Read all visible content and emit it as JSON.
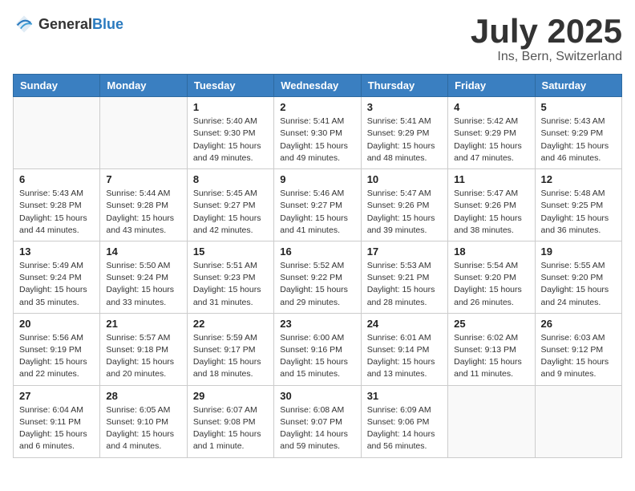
{
  "logo": {
    "general": "General",
    "blue": "Blue"
  },
  "header": {
    "month": "July 2025",
    "location": "Ins, Bern, Switzerland"
  },
  "weekdays": [
    "Sunday",
    "Monday",
    "Tuesday",
    "Wednesday",
    "Thursday",
    "Friday",
    "Saturday"
  ],
  "weeks": [
    [
      {
        "day": "",
        "info": ""
      },
      {
        "day": "",
        "info": ""
      },
      {
        "day": "1",
        "info": "Sunrise: 5:40 AM\nSunset: 9:30 PM\nDaylight: 15 hours and 49 minutes."
      },
      {
        "day": "2",
        "info": "Sunrise: 5:41 AM\nSunset: 9:30 PM\nDaylight: 15 hours and 49 minutes."
      },
      {
        "day": "3",
        "info": "Sunrise: 5:41 AM\nSunset: 9:29 PM\nDaylight: 15 hours and 48 minutes."
      },
      {
        "day": "4",
        "info": "Sunrise: 5:42 AM\nSunset: 9:29 PM\nDaylight: 15 hours and 47 minutes."
      },
      {
        "day": "5",
        "info": "Sunrise: 5:43 AM\nSunset: 9:29 PM\nDaylight: 15 hours and 46 minutes."
      }
    ],
    [
      {
        "day": "6",
        "info": "Sunrise: 5:43 AM\nSunset: 9:28 PM\nDaylight: 15 hours and 44 minutes."
      },
      {
        "day": "7",
        "info": "Sunrise: 5:44 AM\nSunset: 9:28 PM\nDaylight: 15 hours and 43 minutes."
      },
      {
        "day": "8",
        "info": "Sunrise: 5:45 AM\nSunset: 9:27 PM\nDaylight: 15 hours and 42 minutes."
      },
      {
        "day": "9",
        "info": "Sunrise: 5:46 AM\nSunset: 9:27 PM\nDaylight: 15 hours and 41 minutes."
      },
      {
        "day": "10",
        "info": "Sunrise: 5:47 AM\nSunset: 9:26 PM\nDaylight: 15 hours and 39 minutes."
      },
      {
        "day": "11",
        "info": "Sunrise: 5:47 AM\nSunset: 9:26 PM\nDaylight: 15 hours and 38 minutes."
      },
      {
        "day": "12",
        "info": "Sunrise: 5:48 AM\nSunset: 9:25 PM\nDaylight: 15 hours and 36 minutes."
      }
    ],
    [
      {
        "day": "13",
        "info": "Sunrise: 5:49 AM\nSunset: 9:24 PM\nDaylight: 15 hours and 35 minutes."
      },
      {
        "day": "14",
        "info": "Sunrise: 5:50 AM\nSunset: 9:24 PM\nDaylight: 15 hours and 33 minutes."
      },
      {
        "day": "15",
        "info": "Sunrise: 5:51 AM\nSunset: 9:23 PM\nDaylight: 15 hours and 31 minutes."
      },
      {
        "day": "16",
        "info": "Sunrise: 5:52 AM\nSunset: 9:22 PM\nDaylight: 15 hours and 29 minutes."
      },
      {
        "day": "17",
        "info": "Sunrise: 5:53 AM\nSunset: 9:21 PM\nDaylight: 15 hours and 28 minutes."
      },
      {
        "day": "18",
        "info": "Sunrise: 5:54 AM\nSunset: 9:20 PM\nDaylight: 15 hours and 26 minutes."
      },
      {
        "day": "19",
        "info": "Sunrise: 5:55 AM\nSunset: 9:20 PM\nDaylight: 15 hours and 24 minutes."
      }
    ],
    [
      {
        "day": "20",
        "info": "Sunrise: 5:56 AM\nSunset: 9:19 PM\nDaylight: 15 hours and 22 minutes."
      },
      {
        "day": "21",
        "info": "Sunrise: 5:57 AM\nSunset: 9:18 PM\nDaylight: 15 hours and 20 minutes."
      },
      {
        "day": "22",
        "info": "Sunrise: 5:59 AM\nSunset: 9:17 PM\nDaylight: 15 hours and 18 minutes."
      },
      {
        "day": "23",
        "info": "Sunrise: 6:00 AM\nSunset: 9:16 PM\nDaylight: 15 hours and 15 minutes."
      },
      {
        "day": "24",
        "info": "Sunrise: 6:01 AM\nSunset: 9:14 PM\nDaylight: 15 hours and 13 minutes."
      },
      {
        "day": "25",
        "info": "Sunrise: 6:02 AM\nSunset: 9:13 PM\nDaylight: 15 hours and 11 minutes."
      },
      {
        "day": "26",
        "info": "Sunrise: 6:03 AM\nSunset: 9:12 PM\nDaylight: 15 hours and 9 minutes."
      }
    ],
    [
      {
        "day": "27",
        "info": "Sunrise: 6:04 AM\nSunset: 9:11 PM\nDaylight: 15 hours and 6 minutes."
      },
      {
        "day": "28",
        "info": "Sunrise: 6:05 AM\nSunset: 9:10 PM\nDaylight: 15 hours and 4 minutes."
      },
      {
        "day": "29",
        "info": "Sunrise: 6:07 AM\nSunset: 9:08 PM\nDaylight: 15 hours and 1 minute."
      },
      {
        "day": "30",
        "info": "Sunrise: 6:08 AM\nSunset: 9:07 PM\nDaylight: 14 hours and 59 minutes."
      },
      {
        "day": "31",
        "info": "Sunrise: 6:09 AM\nSunset: 9:06 PM\nDaylight: 14 hours and 56 minutes."
      },
      {
        "day": "",
        "info": ""
      },
      {
        "day": "",
        "info": ""
      }
    ]
  ]
}
